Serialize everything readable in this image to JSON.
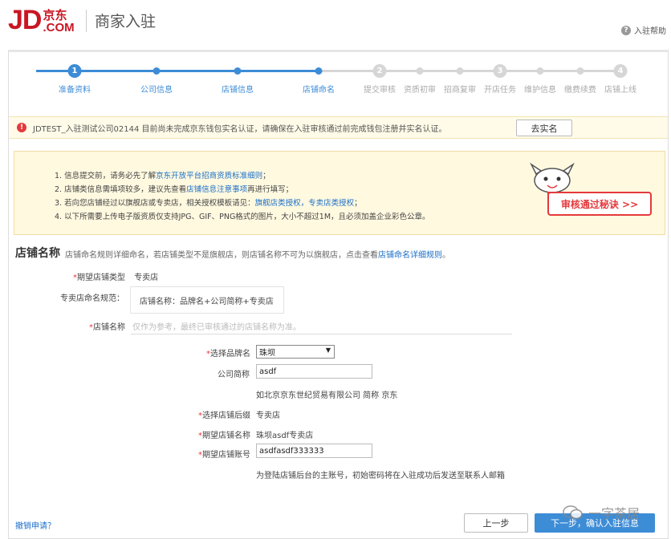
{
  "header": {
    "logo_jd": "JD",
    "logo_cn": "京东",
    "logo_com": ".COM",
    "title": "商家入驻",
    "help_icon": "help-circle-icon",
    "help_label": "入驻帮助"
  },
  "steps": [
    {
      "label": "准备资料",
      "number": "1",
      "state": "done"
    },
    {
      "label": "公司信息",
      "state": "done"
    },
    {
      "label": "店铺信息",
      "state": "done"
    },
    {
      "label": "店铺命名",
      "state": "done"
    },
    {
      "label": "提交审核",
      "number": "2",
      "state": "todo"
    },
    {
      "label": "资质初审",
      "state": "todo"
    },
    {
      "label": "招商复审",
      "state": "todo"
    },
    {
      "label": "开店任务",
      "number": "3",
      "state": "todo"
    },
    {
      "label": "维护信息",
      "state": "todo"
    },
    {
      "label": "缴费续费",
      "state": "todo"
    },
    {
      "label": "店铺上线",
      "number": "4",
      "state": "todo"
    }
  ],
  "warning": {
    "icon": "alert-icon",
    "text": "JDTEST_入驻测试公司02144 目前尚未完成京东钱包实名认证，请确保在入驻审核通过前完成钱包注册并实名认证。",
    "button": "去实名"
  },
  "notice": {
    "items": [
      {
        "before": "1. 信息提交前，请务必先了解",
        "link": "京东开放平台招商资质标准细则",
        "after": "；"
      },
      {
        "before": "2. 店铺类信息需填项较多，建议先查看",
        "link": "店铺信息注意事项",
        "after": "再进行填写；"
      },
      {
        "before": "3. 若向您店铺经过以旗舰店或专卖店，相关授权模板请见：",
        "link": "旗舰店类授权，专卖店类授权",
        "after": "；"
      },
      {
        "before": "4. 以下所需要上传电子版资质仅支持JPG、GIF、PNG格式的图片，大小不超过1M，且必须加盖企业彩色公章。",
        "link": "",
        "after": ""
      }
    ],
    "pass_button": "审核通过秘诀 >>"
  },
  "store_name": {
    "title": "店铺名称",
    "desc_before": "店铺命名规则详细命名，若店铺类型不是旗舰店，则店铺名称不可为以旗舰店，点击查看",
    "desc_link": "店铺命名详细规则",
    "desc_after": "。",
    "expected_type_label": "期望店铺类型",
    "expected_type_value": "专卖店",
    "naming_rule_label": "专卖店命名规范：",
    "naming_rule_value": "店铺名称：品牌名+公司简称+专卖店",
    "keyword_label": "店铺名称",
    "keyword_placeholder": "仅作为参考，最终已审核通过的店铺名称为准。",
    "brand_label": "选择品牌名",
    "brand_value": "珠坝",
    "company_short_label": "公司简称",
    "company_short_value": "asdf",
    "company_short_hint": "如北京京东世纪贸易有限公司 简称 京东",
    "suffix_label": "选择店铺后缀",
    "suffix_value": "专卖店",
    "expected_name_label": "期望店铺名称",
    "expected_name_value": "珠坝asdf专卖店",
    "expected_account_label": "期望店铺账号",
    "expected_account_value": "asdfasdf333333",
    "account_hint": "为登陆店铺后台的主账号，初始密码将在入驻成功后发送至联系人邮箱"
  },
  "footer": {
    "cancel_link": "撤销申请？",
    "prev_button": "上一步",
    "next_button": "下一步，确认入驻信息",
    "watermark": "一字茶居"
  },
  "colors": {
    "brand_red": "#c91623",
    "accent_blue": "#3d8cd6"
  }
}
